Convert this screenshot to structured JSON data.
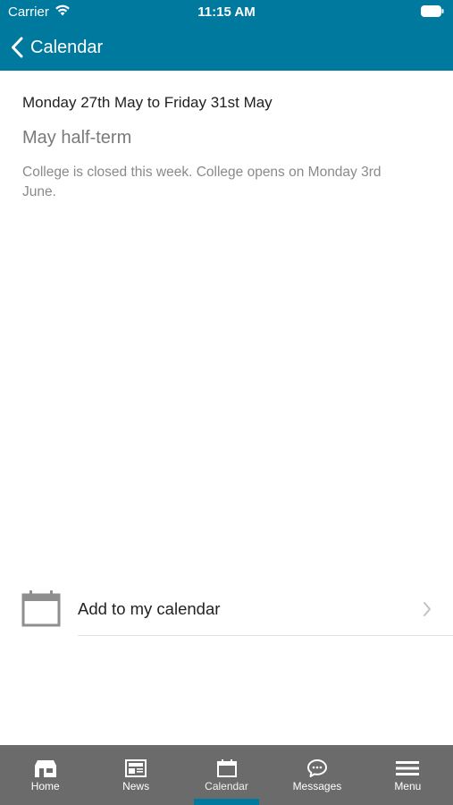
{
  "status_bar": {
    "carrier": "Carrier",
    "time": "11:15 AM",
    "wifi_icon": "wifi-icon",
    "battery_icon": "battery-icon"
  },
  "nav": {
    "title": "Calendar",
    "back_icon": "chevron-left-icon"
  },
  "event": {
    "dates": "Monday 27th May to Friday 31st May",
    "title": "May half-term",
    "description": "College is closed this week. College opens on Monday 3rd June."
  },
  "add_to_calendar": {
    "label": "Add to my calendar",
    "icon": "calendar-icon",
    "chevron_icon": "chevron-right-icon"
  },
  "tab_bar": {
    "tabs": [
      {
        "label": "Home",
        "icon": "home-icon",
        "active": false
      },
      {
        "label": "News",
        "icon": "newspaper-icon",
        "active": false
      },
      {
        "label": "Calendar",
        "icon": "calendar-icon",
        "active": true
      },
      {
        "label": "Messages",
        "icon": "chat-bubble-icon",
        "active": false
      },
      {
        "label": "Menu",
        "icon": "hamburger-menu-icon",
        "active": false
      }
    ]
  },
  "colors": {
    "brand": "#00799e",
    "tab_bar_background": "#6b6b6b",
    "secondary_text": "#8a8a8a"
  }
}
